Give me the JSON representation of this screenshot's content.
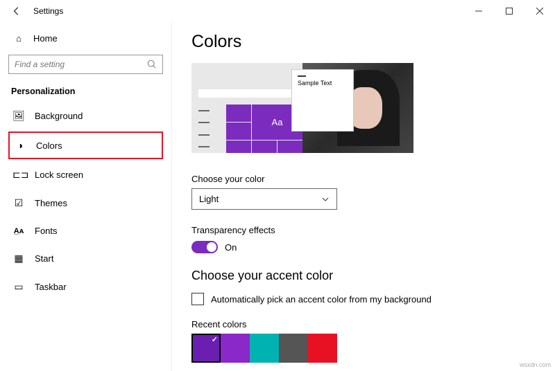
{
  "window": {
    "title": "Settings"
  },
  "sidebar": {
    "home_label": "Home",
    "search_placeholder": "Find a setting",
    "section_label": "Personalization",
    "items": [
      {
        "label": "Background"
      },
      {
        "label": "Colors"
      },
      {
        "label": "Lock screen"
      },
      {
        "label": "Themes"
      },
      {
        "label": "Fonts"
      },
      {
        "label": "Start"
      },
      {
        "label": "Taskbar"
      }
    ]
  },
  "content": {
    "page_title": "Colors",
    "preview_sample_text": "Sample Text",
    "preview_tile_letters": "Aa",
    "color_mode": {
      "label": "Choose your color",
      "value": "Light"
    },
    "transparency": {
      "label": "Transparency effects",
      "value": "On"
    },
    "accent": {
      "heading": "Choose your accent color",
      "auto_label": "Automatically pick an accent color from my background",
      "recent_label": "Recent colors",
      "recent_colors": [
        "#6b1fb0",
        "#8a28c9",
        "#00b2b2",
        "#555555",
        "#e81123"
      ]
    }
  },
  "watermark": "wsxdn.com"
}
